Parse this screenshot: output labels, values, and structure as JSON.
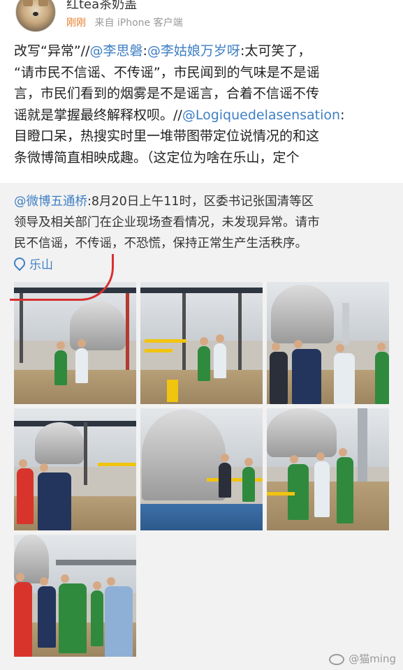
{
  "header": {
    "username": "红tea茶奶盖",
    "time": "刚刚",
    "source": "来自 iPhone 客户端"
  },
  "post": {
    "line1_prefix": "改写“异常”//",
    "mention1": "@李思磐",
    "sep1": ":",
    "mention2": "@李姑娘万岁呀",
    "line1_suffix": ":太可笑了，",
    "line2": "“请市民不信谣、不传谣”，市民闻到的气味是不是谣",
    "line3": "言，市民们看到的烟雾是不是谣言，合着不信谣不传",
    "line4_prefix": "谣就是掌握最终解释权呗。//",
    "mention3": "@Logiquedelasensation",
    "line4_suffix": ":",
    "line5": "目瞪口呆，热搜实时里一堆带图带定位说情况的和这",
    "line6": "条微博简直相映成趣。（这定位为啥在乐山，定个"
  },
  "quote": {
    "mention": "@微博五通桥",
    "line1": ":8月20日上午11时，区委书记张国清等区",
    "line2": "领导及相关部门在企业现场查看情况，未发现异常。请市",
    "line3": "民不信谣，不传谣，不恐慌，保持正常生产生活秩序。",
    "location": "乐山",
    "location_icon": "location-pin-icon"
  },
  "gallery": {
    "photos": [
      "photo-1-industrial-site-workers",
      "photo-2-officials-yellow-pipes",
      "photo-3-officials-tanks",
      "photo-4-crowd-under-structure",
      "photo-5-large-tank",
      "photo-6-workers-red-helmets",
      "photo-7-group-standing"
    ]
  },
  "watermark": {
    "text": "@猫ming",
    "icon": "weibo-eye-icon"
  },
  "colors": {
    "link": "#3e7fc4",
    "time": "#e87b24",
    "quote_bg": "#f2f2f2",
    "annotation": "#d93030"
  }
}
